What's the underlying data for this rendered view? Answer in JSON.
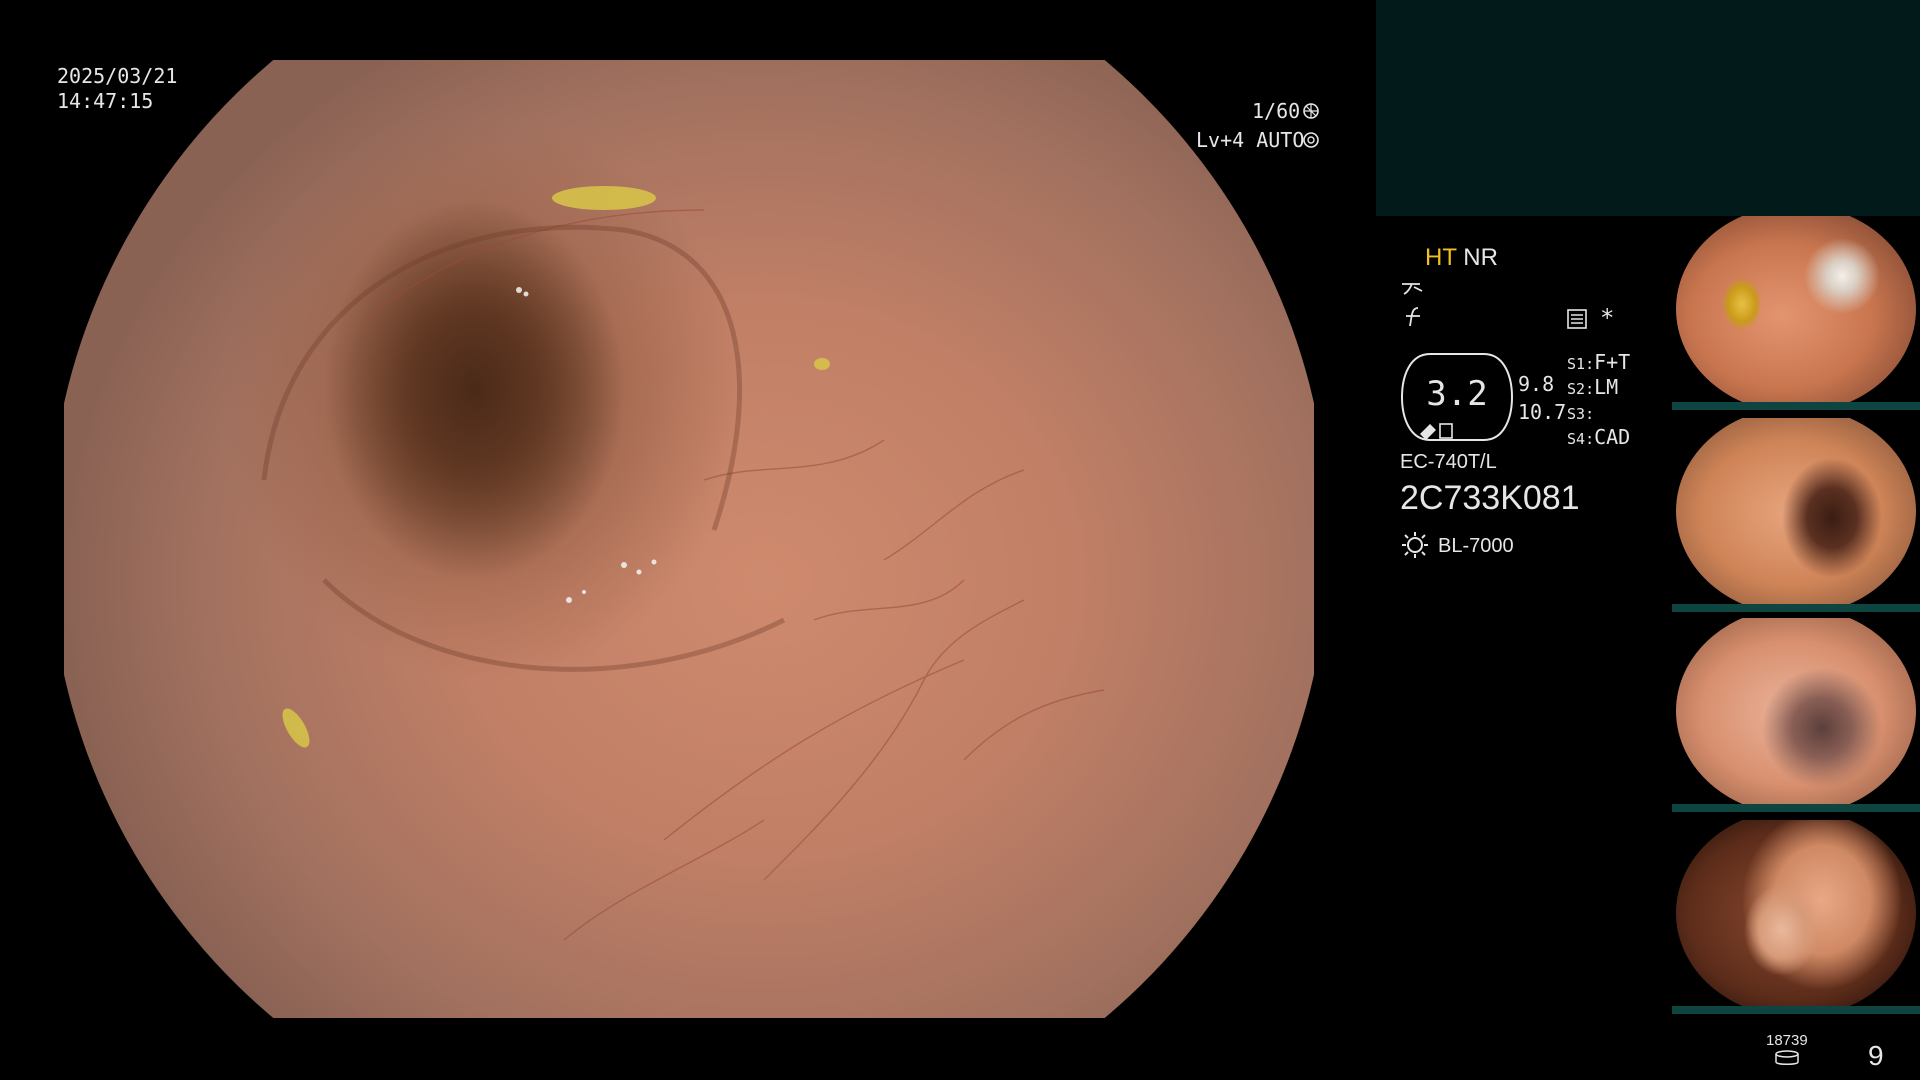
{
  "overlay": {
    "date": "2025/03/21",
    "time": "14:47:15",
    "shutter": "1/60",
    "level": "Lv+4",
    "mode": "AUTO"
  },
  "status": {
    "ht": "HT",
    "nr": "NR",
    "asterisk": "*",
    "zoom_value": "3.2",
    "value_a": "9.8",
    "value_b": "10.7",
    "scope_model": "EC-740T/L",
    "serial": "2C733K081",
    "light_source": "BL-7000"
  },
  "settings": [
    {
      "key": "S1",
      "value": "F+T"
    },
    {
      "key": "S2",
      "value": "LM"
    },
    {
      "key": "S3",
      "value": ""
    },
    {
      "key": "S4",
      "value": "CAD"
    }
  ],
  "storage": {
    "count": "18739",
    "index": "9"
  },
  "colors": {
    "panel_bg": "#021a19",
    "highlight": "#f0c020",
    "thumb_bar": "#0f4540"
  }
}
